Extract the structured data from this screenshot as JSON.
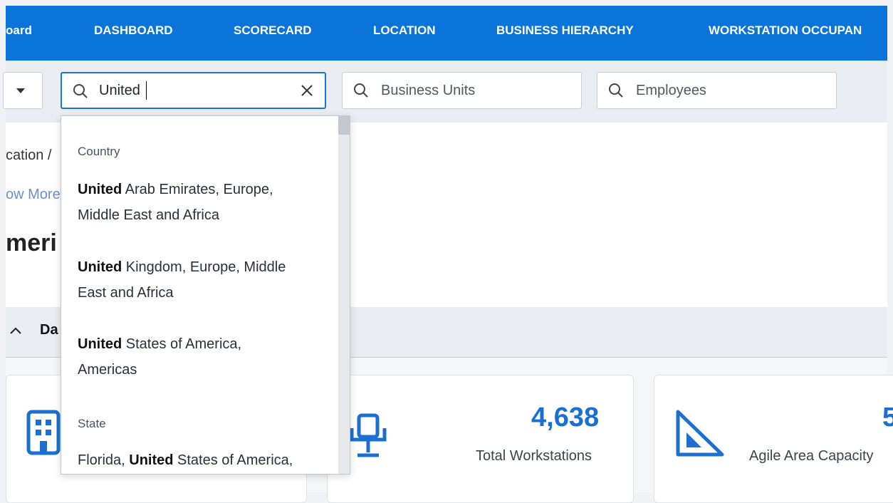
{
  "nav": {
    "tabs": [
      "oard",
      "DASHBOARD",
      "SCORECARD",
      "LOCATION",
      "BUSINESS HIERARCHY",
      "WORKSTATION OCCUPAN"
    ]
  },
  "filters": {
    "location_search": {
      "value": "United"
    },
    "business_units": {
      "placeholder": "Business Units"
    },
    "employees": {
      "placeholder": "Employees"
    }
  },
  "content": {
    "breadcrumb": "cation  /",
    "show_more": "ow More",
    "heading": "meri"
  },
  "band": {
    "label": "Da"
  },
  "cards": [
    {
      "value": "",
      "caption": ""
    },
    {
      "value": "4,638",
      "caption": "Total Workstations"
    },
    {
      "value": "5",
      "caption": "Agile Area Capacity"
    }
  ],
  "dropdown": {
    "groups": [
      {
        "label": "Country",
        "items": [
          {
            "match": "United",
            "line1": " Arab Emirates, Europe,",
            "line2": "Middle East and Africa"
          },
          {
            "match": "United",
            "line1": " Kingdom, Europe, Middle",
            "line2": "East and Africa"
          },
          {
            "match": "United",
            "line1": " States of America,",
            "line2": "Americas"
          }
        ]
      },
      {
        "label": "State",
        "items": [
          {
            "prefix": "Florida, ",
            "match": "United",
            "line1": " States of America,"
          }
        ]
      }
    ]
  },
  "colors": {
    "nav_bg": "#0a74da",
    "accent": "#1a6fd0",
    "focus_border": "#1a73d9"
  }
}
